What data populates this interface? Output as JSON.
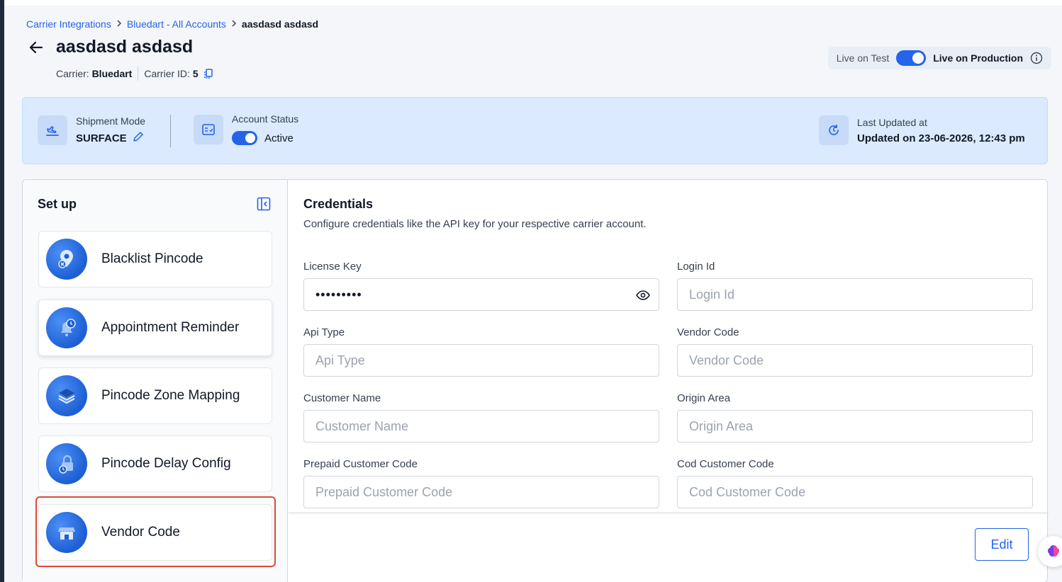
{
  "breadcrumb": {
    "items": [
      "Carrier Integrations",
      "Bluedart - All Accounts"
    ],
    "current": "aasdasd asdasd"
  },
  "header": {
    "title": "aasdasd asdasd",
    "carrier_label": "Carrier:",
    "carrier_value": "Bluedart",
    "carrier_id_label": "Carrier ID:",
    "carrier_id_value": "5"
  },
  "environment": {
    "test_label": "Live on Test",
    "prod_label": "Live on Production",
    "production_enabled": true
  },
  "status": {
    "shipment_mode_label": "Shipment Mode",
    "shipment_mode_value": "SURFACE",
    "account_status_label": "Account Status",
    "account_status_value": "Active",
    "account_active": true,
    "last_updated_label": "Last Updated at",
    "last_updated_value": "Updated on 23-06-2026, 12:43 pm"
  },
  "setup": {
    "title": "Set up",
    "items": [
      {
        "label": "Blacklist Pincode",
        "icon": "map-pin-x-icon"
      },
      {
        "label": "Appointment Reminder",
        "icon": "bell-clock-icon"
      },
      {
        "label": "Pincode Zone Mapping",
        "icon": "layers-icon"
      },
      {
        "label": "Pincode Delay Config",
        "icon": "lock-clock-icon"
      },
      {
        "label": "Vendor Code",
        "icon": "storefront-icon"
      }
    ]
  },
  "credentials": {
    "title": "Credentials",
    "description": "Configure credentials like the API key for your respective carrier account.",
    "fields": [
      {
        "label": "License Key",
        "value": "•••••••••",
        "placeholder": ""
      },
      {
        "label": "Login Id",
        "value": "",
        "placeholder": "Login Id"
      },
      {
        "label": "Api Type",
        "value": "",
        "placeholder": "Api Type"
      },
      {
        "label": "Vendor Code",
        "value": "",
        "placeholder": "Vendor Code"
      },
      {
        "label": "Customer Name",
        "value": "",
        "placeholder": "Customer Name"
      },
      {
        "label": "Origin Area",
        "value": "",
        "placeholder": "Origin Area"
      },
      {
        "label": "Prepaid Customer Code",
        "value": "",
        "placeholder": "Prepaid Customer Code"
      },
      {
        "label": "Cod Customer Code",
        "value": "",
        "placeholder": "Cod Customer Code"
      }
    ],
    "edit_label": "Edit"
  },
  "colors": {
    "accent": "#2563eb",
    "status_bg": "#dbeafe",
    "highlight": "#d94b37"
  }
}
